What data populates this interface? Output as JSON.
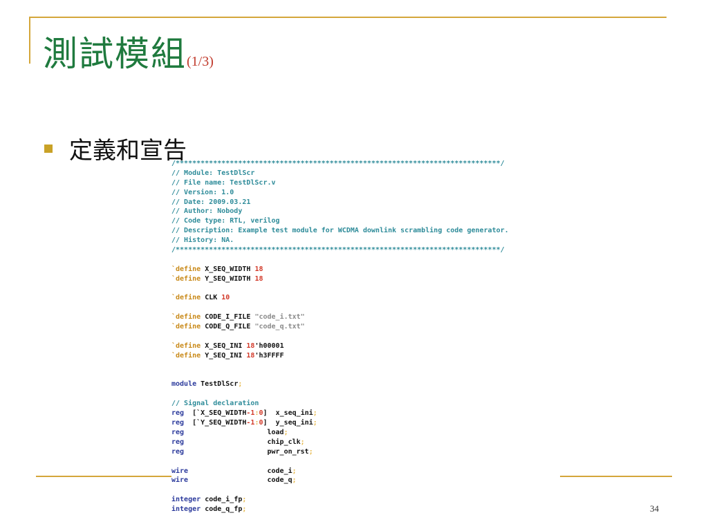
{
  "slide": {
    "title": "測試模組",
    "title_suffix": "(1/3)",
    "bullet": "定義和宣告",
    "page_number": "34"
  },
  "colors": {
    "accent_gold": "#d4a63a",
    "title_green": "#1f7a3e",
    "suffix_red": "#c0392b",
    "comment": "#2f8c9a",
    "keyword": "#2b3a9c",
    "number": "#d23a2a",
    "string": "#8a8a8a"
  },
  "code": {
    "header_rule_top": "/******************************************************************************/",
    "header_lines": [
      "// Module: TestDlScr",
      "// File name: TestDlScr.v",
      "// Version: 1.0",
      "// Date: 2009.03.21",
      "// Author: Nobody",
      "// Code type: RTL, verilog",
      "// Description: Example test module for WCDMA downlink scrambling code generator.",
      "// History: NA."
    ],
    "header_rule_bottom": "/******************************************************************************/",
    "kw_define": "`define",
    "def1": {
      "name": "X_SEQ_WIDTH",
      "value": "18"
    },
    "def2": {
      "name": "Y_SEQ_WIDTH",
      "value": "18"
    },
    "def3": {
      "name": "CLK",
      "value": "10"
    },
    "def4": {
      "name": "CODE_I_FILE",
      "value": "\"code_i.txt\""
    },
    "def5": {
      "name": "CODE_Q_FILE",
      "value": "\"code_q.txt\""
    },
    "def6": {
      "name": "X_SEQ_INI",
      "width": "18",
      "value": "'h00001"
    },
    "def7": {
      "name": "Y_SEQ_INI",
      "width": "18",
      "value": "'h3FFFF"
    },
    "kw_module": "module",
    "module_name": "TestDlScr",
    "signal_comment": "// Signal declaration",
    "kw_reg": "reg",
    "kw_wire": "wire",
    "kw_integer": "integer",
    "minus_one": "-1",
    "zero": "0",
    "x_width_ref": "`X_SEQ_WIDTH",
    "y_width_ref": "`Y_SEQ_WIDTH",
    "sig_x": "x_seq_ini",
    "sig_y": "y_seq_ini",
    "sig_load": "load",
    "sig_chip": "chip_clk",
    "sig_pwr": "pwr_on_rst",
    "sig_ci": "code_i",
    "sig_cq": "code_q",
    "sig_cifp": "code_i_fp",
    "sig_cqfp": "code_q_fp"
  }
}
